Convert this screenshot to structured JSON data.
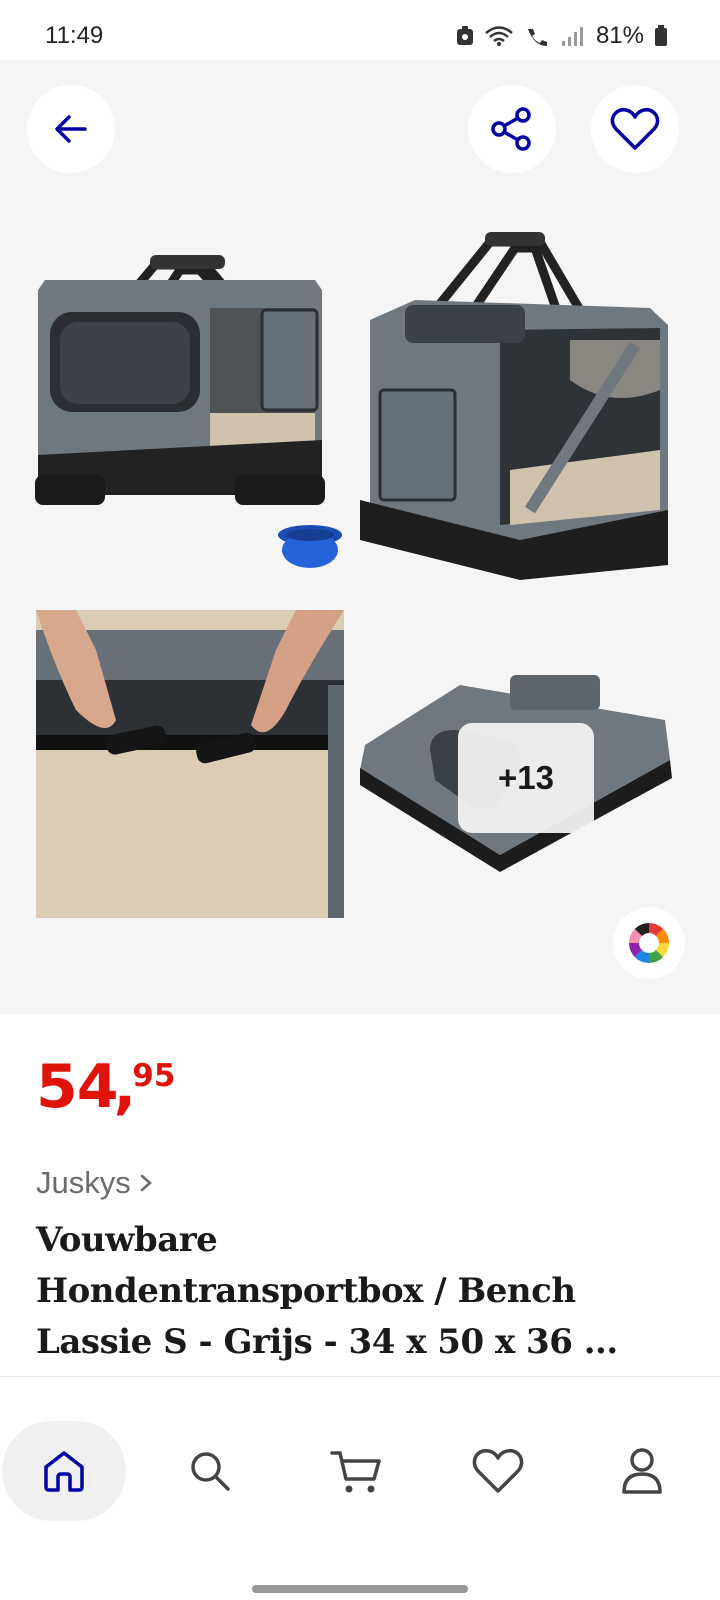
{
  "status_bar": {
    "time": "11:49",
    "battery": "81%"
  },
  "gallery": {
    "back_icon": "arrow-left-icon",
    "share_icon": "share-icon",
    "favorite_icon": "heart-icon",
    "more_images_label": "+13",
    "color_options_icon": "color-wheel-icon"
  },
  "product": {
    "price_whole": "54",
    "price_decimal": "95",
    "brand": "Juskys",
    "title_lines": [
      "Vouwbare",
      "Hondentransportbox / Bench",
      "Lassie S - Grijs - 34 x 50 x 36 ..."
    ]
  },
  "bottom_nav": {
    "items": [
      {
        "icon": "home-icon",
        "active": true
      },
      {
        "icon": "search-icon",
        "active": false
      },
      {
        "icon": "cart-icon",
        "active": false
      },
      {
        "icon": "heart-icon",
        "active": false
      },
      {
        "icon": "user-icon",
        "active": false
      }
    ]
  },
  "colors": {
    "accent_blue": "#0000a4",
    "price_red": "#e0130a"
  }
}
